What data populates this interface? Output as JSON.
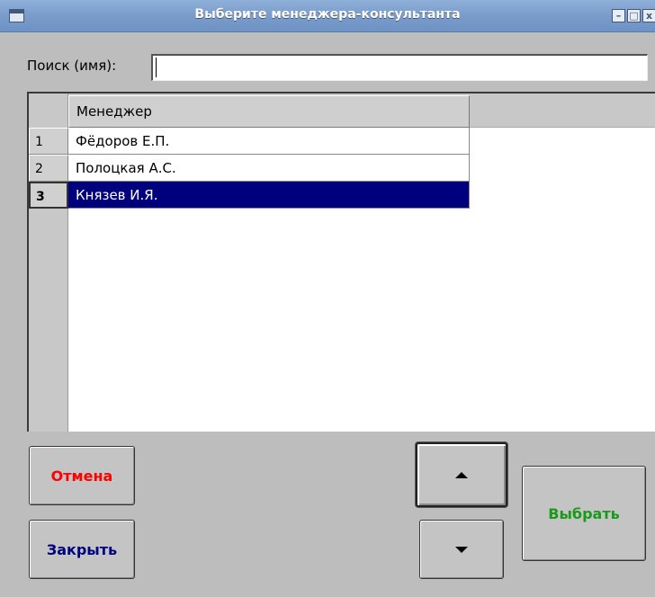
{
  "window": {
    "title": "Выберите менеджера-консультанта",
    "controls": [
      "minimize-icon",
      "maximize-icon",
      "close-icon"
    ]
  },
  "search": {
    "label": "Поиск (имя):",
    "value": ""
  },
  "grid": {
    "column_header": "Менеджер",
    "rows": [
      {
        "num": "1",
        "name": "Фёдоров Е.П."
      },
      {
        "num": "2",
        "name": "Полоцкая А.С."
      },
      {
        "num": "3",
        "name": "Князев И.Я."
      }
    ],
    "selected_row": 3,
    "selection_color": "#00007e"
  },
  "buttons": {
    "cancel": "Отмена",
    "close": "Закрыть",
    "select": "Выбрать",
    "up_icon": "arrow-up-icon",
    "down_icon": "arrow-down-icon"
  },
  "colors": {
    "cancel_text": "#ff0000",
    "close_text": "#000080",
    "select_text": "#1a9a1a"
  }
}
